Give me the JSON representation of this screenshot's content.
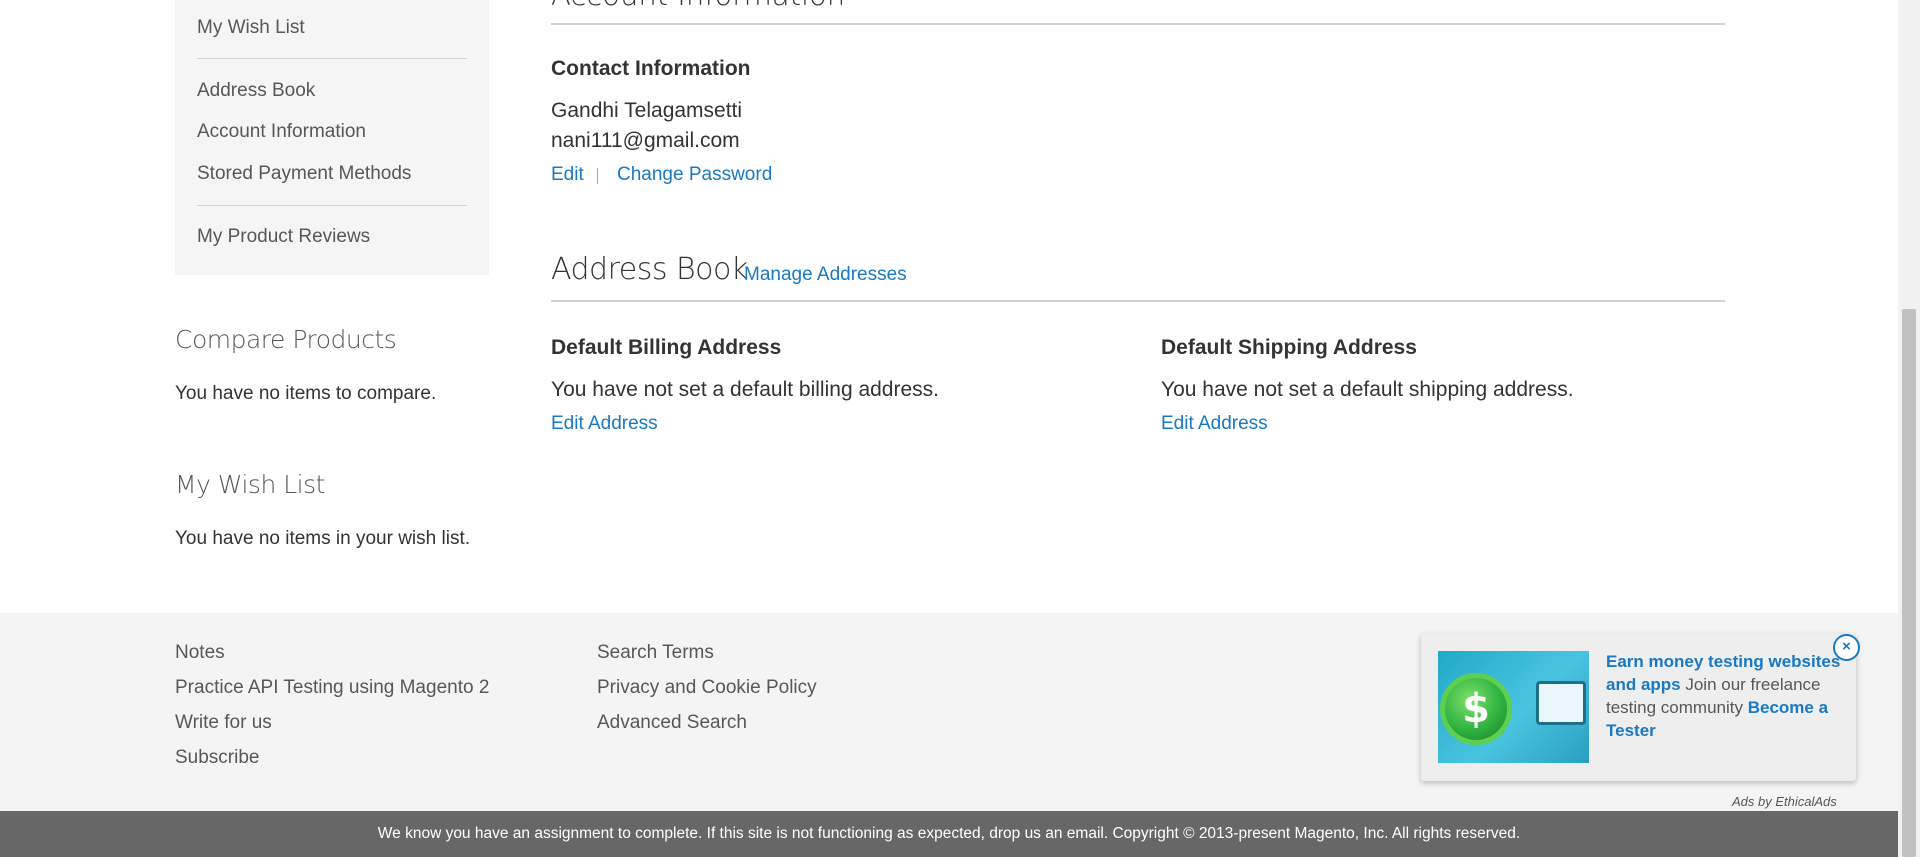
{
  "sidebar": {
    "items": [
      {
        "label": "My Wish List"
      },
      {
        "label": "Address Book"
      },
      {
        "label": "Account Information"
      },
      {
        "label": "Stored Payment Methods"
      },
      {
        "label": "My Product Reviews"
      }
    ]
  },
  "compare": {
    "title": "Compare Products",
    "text": "You have no items to compare."
  },
  "wishlist": {
    "title": "My Wish List",
    "text": "You have no items in your wish list."
  },
  "account_info": {
    "title": "Account Information",
    "contact_heading": "Contact Information",
    "name": "Gandhi Telagamsetti",
    "email": "nani111@gmail.com",
    "edit_label": "Edit",
    "change_password_label": "Change Password"
  },
  "address_book": {
    "title": "Address Book",
    "manage_label": "Manage Addresses",
    "billing_heading": "Default Billing Address",
    "billing_text": "You have not set a default billing address.",
    "billing_edit_label": "Edit Address",
    "shipping_heading": "Default Shipping Address",
    "shipping_text": "You have not set a default shipping address.",
    "shipping_edit_label": "Edit Address"
  },
  "footer": {
    "col1": [
      "Notes",
      "Practice API Testing using Magento 2",
      "Write for us",
      "Subscribe"
    ],
    "col2": [
      "Search Terms",
      "Privacy and Cookie Policy",
      "Advanced Search"
    ]
  },
  "ad": {
    "headline": "Earn money testing websites and apps",
    "body": " Join our freelance testing community ",
    "cta": "Become a Tester",
    "close_label": "×",
    "attribution": "Ads by EthicalAds",
    "coin_symbol": "$"
  },
  "notice": "We know you have an assignment to complete. If this site is not functioning as expected, drop us an email. Copyright © 2013-present Magento, Inc. All rights reserved.",
  "colors": {
    "link": "#1979c3",
    "sidebar_bg": "#f5f5f5",
    "footer_bg": "#f4f4f4",
    "notice_bg": "#676767"
  }
}
